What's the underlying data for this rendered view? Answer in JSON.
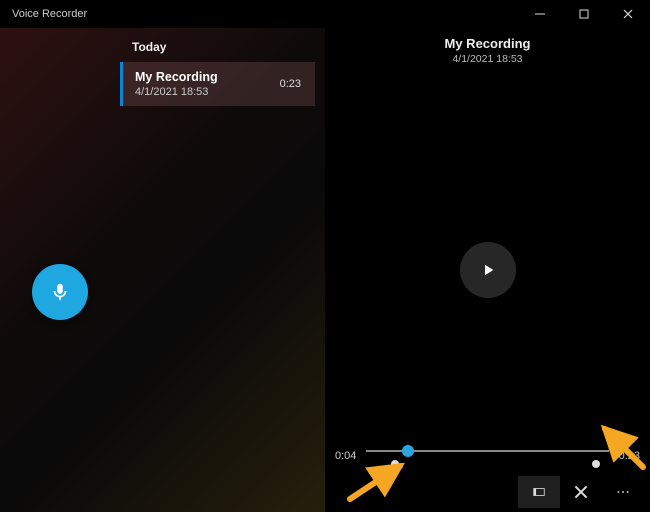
{
  "app_title": "Voice Recorder",
  "accent": "#1ea7e0",
  "sidebar": {
    "section_label": "Today",
    "recordings": [
      {
        "title": "My Recording",
        "datetime": "4/1/2021 18:53",
        "duration": "0:23"
      }
    ]
  },
  "detail": {
    "title": "My Recording",
    "datetime": "4/1/2021 18:53",
    "current_time": "0:04",
    "total_time": "0:23",
    "progress_percent": 17,
    "markers_percent": [
      12,
      95
    ]
  },
  "icons": {
    "record": "microphone-icon",
    "play": "play-icon",
    "share": "share-icon",
    "trim": "trim-icon",
    "delete": "delete-icon",
    "more": "more-icon",
    "minimize": "minimize-icon",
    "maximize": "maximize-icon",
    "close": "close-icon"
  }
}
